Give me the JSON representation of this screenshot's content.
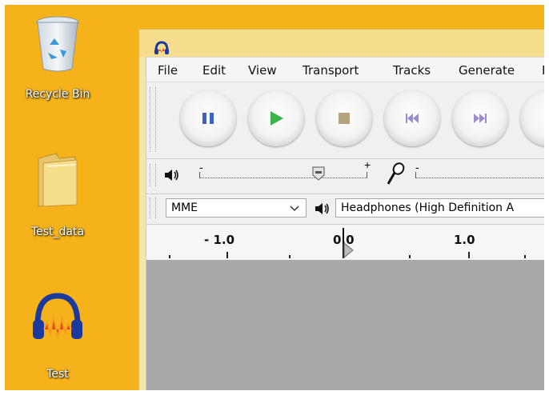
{
  "desktop": {
    "icons": [
      {
        "label": "Recycle Bin",
        "icon": "recycle-bin-icon"
      },
      {
        "label": "Test_data",
        "icon": "folder-icon"
      },
      {
        "label": "Test",
        "icon": "audacity-icon"
      }
    ],
    "background_color": "#f5b21a"
  },
  "app": {
    "title_icon": "audacity-headphones-icon",
    "menu": [
      "File",
      "Edit",
      "View",
      "Transport",
      "Tracks",
      "Generate",
      "E"
    ],
    "transport": {
      "buttons": [
        "pause-icon",
        "play-icon",
        "stop-icon",
        "skip-to-start-icon",
        "skip-to-end-icon"
      ],
      "colors": {
        "pause": "#3a63c7",
        "play": "#39b54a",
        "stop": "#b5a37e",
        "skip": "#9a8ccf"
      }
    },
    "mixer": {
      "playback_minus": "-",
      "playback_plus": "+",
      "recording_minus": "-",
      "playback_level_fraction": 0.73
    },
    "devices": {
      "host": "MME",
      "output": "Headphones (High Definition A"
    },
    "ruler": {
      "labels": [
        "- 1.0",
        "0.0",
        "1.0"
      ]
    }
  }
}
